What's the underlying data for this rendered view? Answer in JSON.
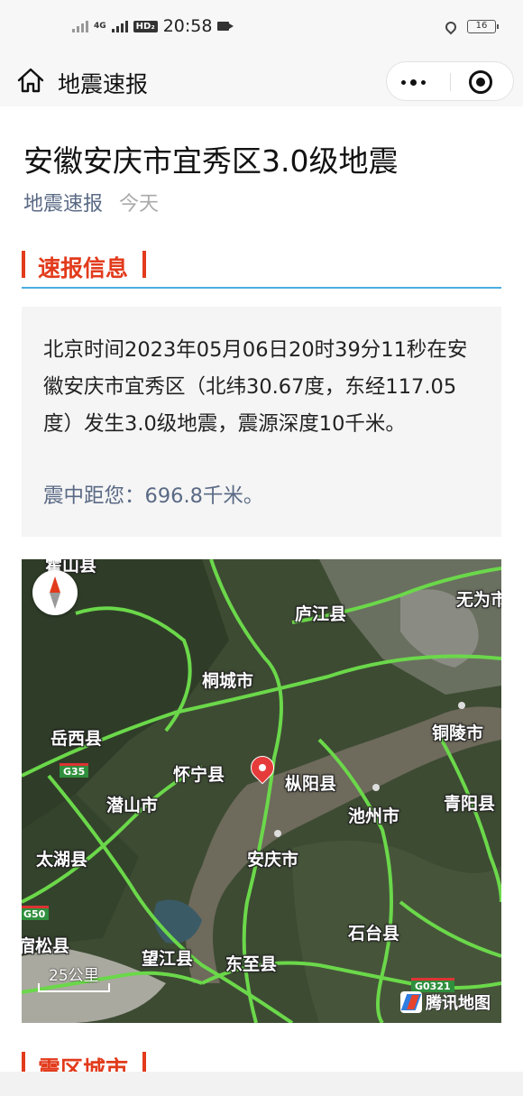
{
  "status_bar": {
    "network": "4G",
    "hd": "HD₂",
    "time": "20:58",
    "battery": "16"
  },
  "nav": {
    "title": "地震速报"
  },
  "article": {
    "title": "安徽安庆市宜秀区3.0级地震",
    "source": "地震速报",
    "date": "今天"
  },
  "section_report": {
    "label": "速报信息"
  },
  "report": {
    "text": "北京时间2023年05月06日20时39分11秒在安徽安庆市宜秀区（北纬30.67度，东经117.05度）发生3.0级地震，震源深度10千米。",
    "distance": "震中距您：696.8千米。"
  },
  "map": {
    "labels": [
      "霍山县",
      "庐江县",
      "无为市",
      "桐城市",
      "岳西县",
      "铜陵市",
      "怀宁县",
      "枞阳县",
      "潜山市",
      "池州市",
      "青阳县",
      "太湖县",
      "安庆市",
      "石台县",
      "宿松县",
      "望江县",
      "东至县"
    ],
    "roads": [
      "G35",
      "G50",
      "G0321"
    ],
    "scale": "25公里",
    "logo": "腾讯地图"
  },
  "section_cities": {
    "label": "震区城市"
  },
  "colors": {
    "accent": "#e23b1c",
    "underline": "#4aaee0",
    "source_text": "#5a6a85",
    "roads": "#6bd84a"
  }
}
